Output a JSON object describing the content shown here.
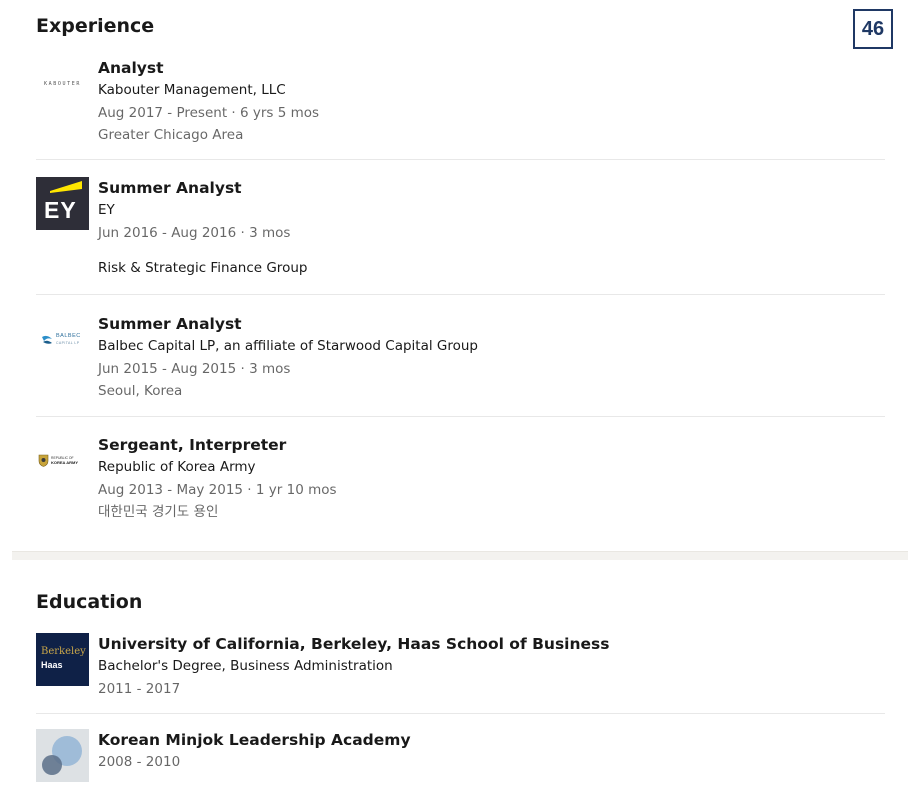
{
  "page_badge": "46",
  "experience": {
    "heading": "Experience",
    "items": [
      {
        "logo_text": "KABOUTER",
        "title": "Analyst",
        "company": "Kabouter Management, LLC",
        "dates": "Aug 2017 - Present · 6 yrs 5 mos",
        "location": "Greater Chicago Area"
      },
      {
        "logo_text": "EY",
        "title": "Summer Analyst",
        "company": "EY",
        "dates": "Jun 2016 - Aug 2016 · 3 mos",
        "description": "Risk & Strategic Finance Group"
      },
      {
        "logo_text": "BALBEC",
        "logo_subtext": "CAPITAL LP",
        "title": "Summer Analyst",
        "company": "Balbec Capital LP, an affiliate of Starwood Capital Group",
        "dates": "Jun 2015 - Aug 2015 · 3 mos",
        "location": "Seoul, Korea"
      },
      {
        "logo_text": "REPUBLIC OF",
        "logo_subtext": "KOREA ARMY",
        "title": "Sergeant, Interpreter",
        "company": "Republic of Korea Army",
        "dates": "Aug 2013 - May 2015 · 1 yr 10 mos",
        "location": "대한민국 경기도 용인"
      }
    ]
  },
  "education": {
    "heading": "Education",
    "items": [
      {
        "logo_text": "Berkeley",
        "logo_subtext": "Haas",
        "school": "University of California, Berkeley, Haas School of Business",
        "degree": "Bachelor's Degree, Business Administration",
        "dates": "2011 - 2017"
      },
      {
        "school": "Korean Minjok Leadership Academy",
        "dates": "2008 - 2010"
      }
    ]
  },
  "colors": {
    "badge": "#1f3864",
    "ey_yellow": "#ffe600",
    "ey_dark": "#2e2e38",
    "berkeley_navy": "#0f2147",
    "berkeley_gold": "#c9a649"
  }
}
